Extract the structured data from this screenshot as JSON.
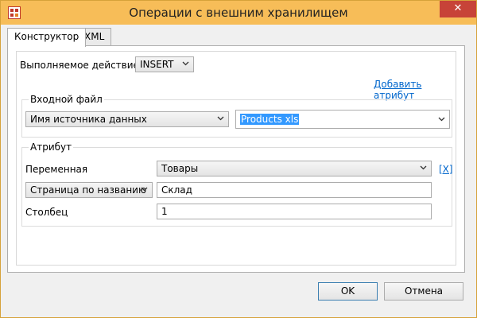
{
  "window": {
    "title": "Операции с внешним хранилищем",
    "close_symbol": "✕"
  },
  "tabs": [
    {
      "label": "Конструктор"
    },
    {
      "label": "XML"
    }
  ],
  "constructor": {
    "action_label": "Выполняемое действие",
    "action_value": "INSERT",
    "add_attribute_link": "Добавить атрибут",
    "input_file": {
      "title": "Входной файл",
      "source_type": "Имя источника данных",
      "source_value": "Products xls"
    },
    "attribute": {
      "title": "Атрибут",
      "variable_label": "Переменная",
      "variable_value": "Товары",
      "remove_link": "[X]",
      "page_mode": "Страница по названию",
      "page_value": "Склад",
      "column_label": "Столбец",
      "column_value": "1"
    }
  },
  "footer": {
    "ok_label": "OK",
    "cancel_label": "Отмена"
  },
  "colors": {
    "titlebar": "#f7bd58",
    "close": "#c74338",
    "link": "#0066cc",
    "selection": "#3399ff"
  }
}
